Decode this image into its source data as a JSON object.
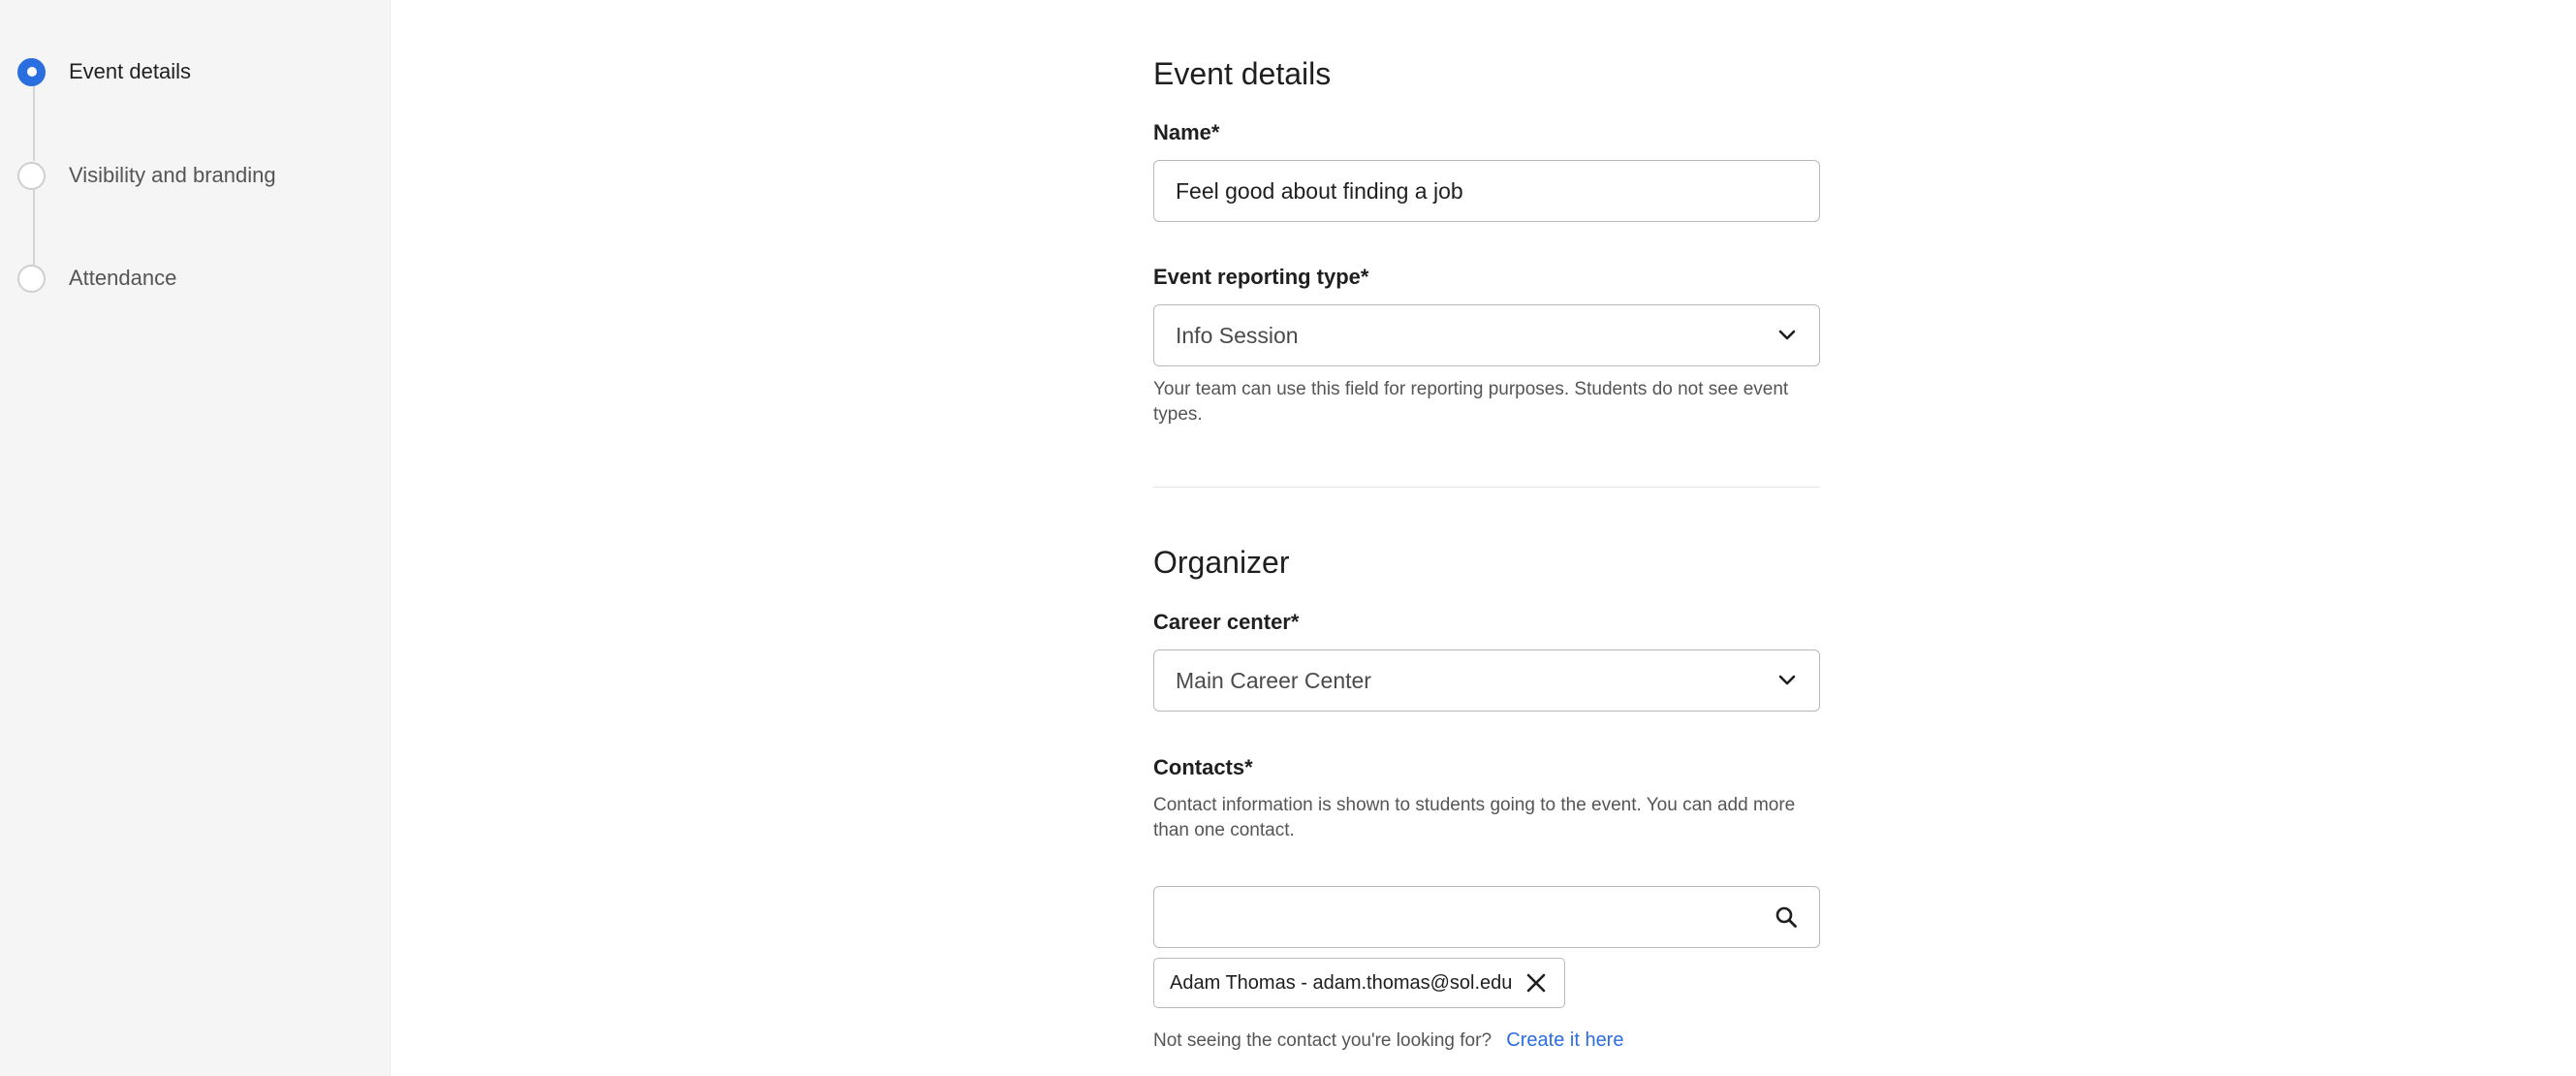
{
  "stepper": {
    "steps": [
      {
        "label": "Event details",
        "state": "active"
      },
      {
        "label": "Visibility and branding",
        "state": "pending"
      },
      {
        "label": "Attendance",
        "state": "pending"
      }
    ]
  },
  "event_details": {
    "title": "Event details",
    "name": {
      "label": "Name*",
      "value": "Feel good about finding a job"
    },
    "reporting_type": {
      "label": "Event reporting type*",
      "selected": "Info Session",
      "help": "Your team can use this field for reporting purposes. Students do not see event types."
    }
  },
  "organizer": {
    "title": "Organizer",
    "career_center": {
      "label": "Career center*",
      "selected": "Main Career Center"
    },
    "contacts": {
      "label": "Contacts*",
      "help": "Contact information is shown to students going to the event. You can add more than one contact.",
      "search_value": "",
      "selected_contacts": [
        {
          "label": "Adam Thomas - adam.thomas@sol.edu"
        }
      ],
      "not_found_text": "Not seeing the contact you're looking for?",
      "create_link": "Create it here"
    }
  },
  "icons": {
    "chevron": "chevron-down-icon",
    "search": "search-icon",
    "remove": "close-icon"
  },
  "colors": {
    "accent": "#2b6ee0",
    "sidebar_bg": "#f5f5f5",
    "border": "#b9b9b9",
    "muted_text": "#555555"
  }
}
